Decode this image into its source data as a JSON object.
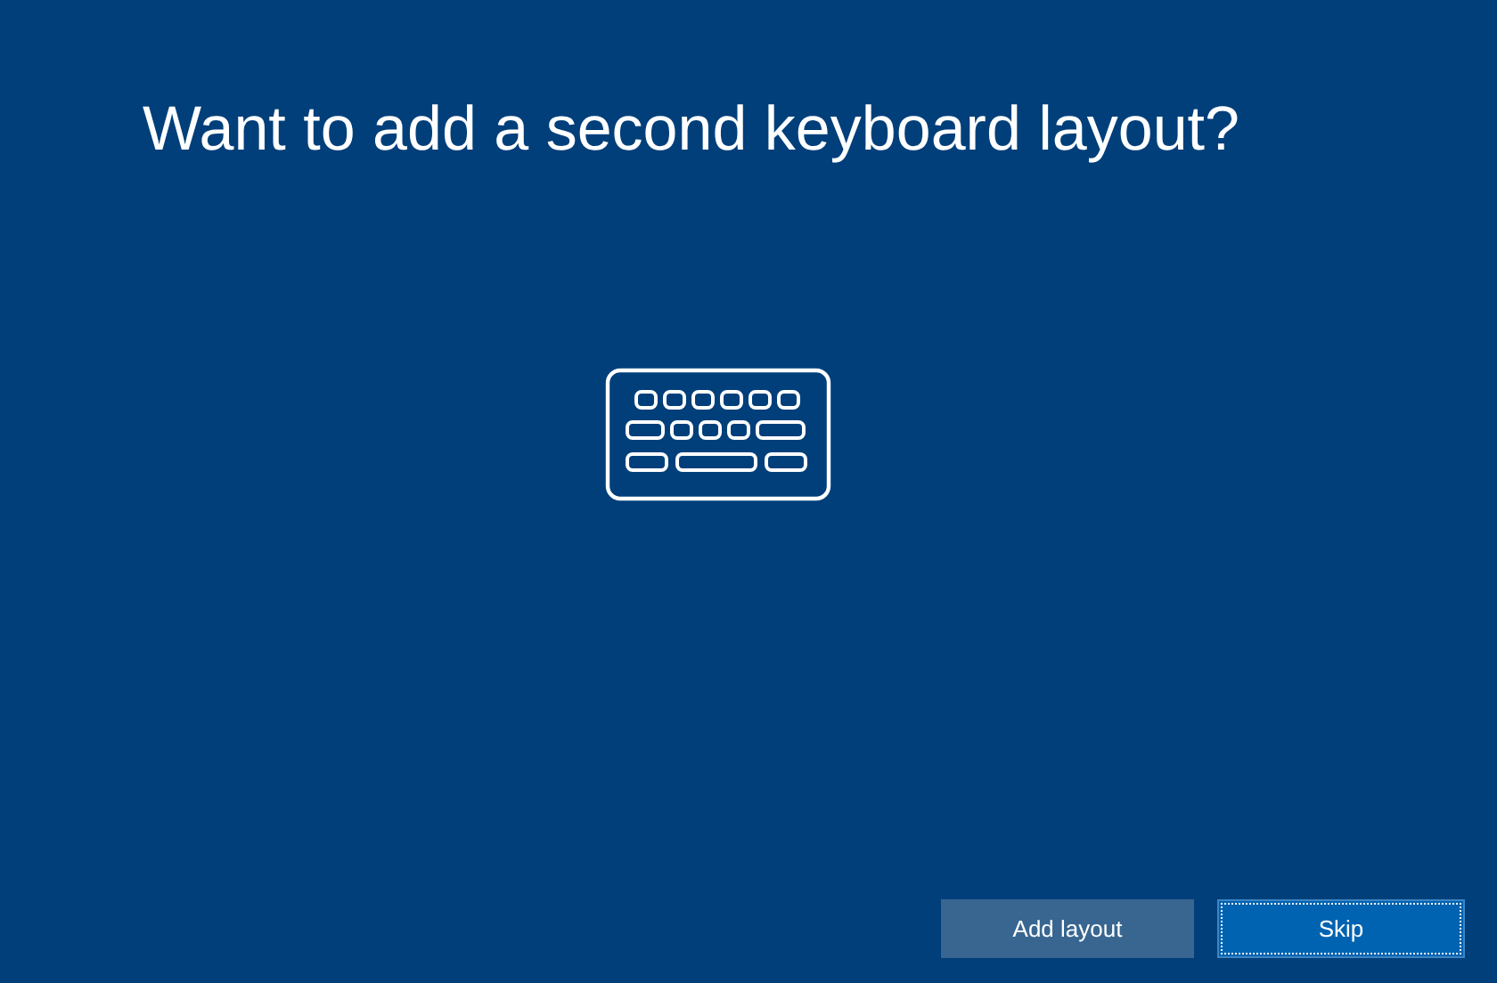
{
  "title": "Want to add a second keyboard layout?",
  "buttons": [
    {
      "label": "Add layout",
      "focused": false
    },
    {
      "label": "Skip",
      "focused": true
    }
  ]
}
